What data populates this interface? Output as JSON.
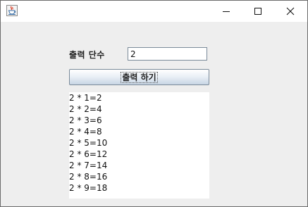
{
  "window": {
    "icon": "java-cup-icon",
    "controls": {
      "minimize": "minimize-icon",
      "maximize": "maximize-icon",
      "close": "close-icon"
    }
  },
  "form": {
    "dan_label": "출력 단수",
    "dan_value": "2",
    "print_button_label": "출력 하기"
  },
  "results": [
    "2 * 1=2",
    "2 * 2=4",
    "2 * 3=6",
    "2 * 4=8",
    "2 * 5=10",
    "2 * 6=12",
    "2 * 7=14",
    "2 * 8=16",
    "2 * 9=18"
  ]
}
